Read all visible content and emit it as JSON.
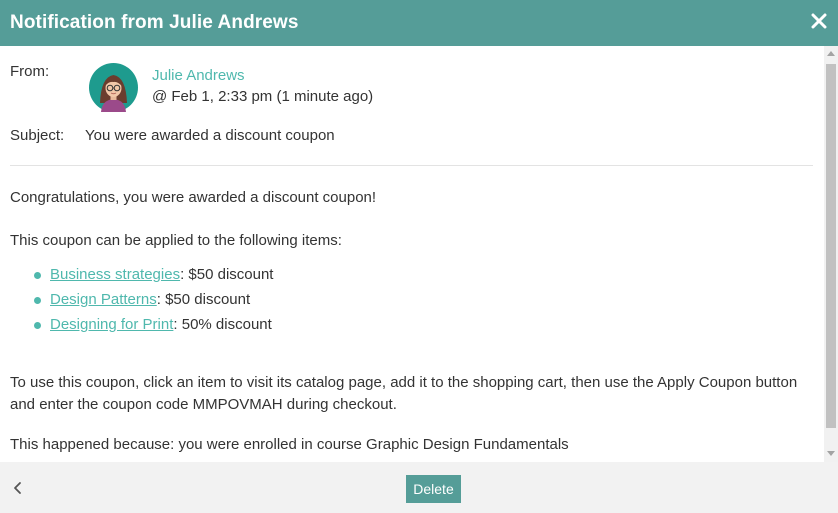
{
  "dialog": {
    "title": "Notification from Julie Andrews"
  },
  "message": {
    "from_label": "From:",
    "sender_name": "Julie Andrews",
    "timestamp": "@ Feb 1, 2:33 pm (1 minute ago)",
    "subject_label": "Subject:",
    "subject": "You were awarded a discount coupon",
    "congrats": "Congratulations, you were awarded a discount coupon!",
    "applies_text": "This coupon can be applied to the following items:",
    "items": [
      {
        "name": "Business strategies",
        "discount": ": $50 discount"
      },
      {
        "name": "Design Patterns",
        "discount": ": $50 discount"
      },
      {
        "name": "Designing for Print",
        "discount": ": 50% discount"
      }
    ],
    "instructions": "To use this coupon, click an item to visit its catalog page, add it to the shopping cart, then use the Apply Coupon button and enter the coupon code MMPOVMAH during checkout.",
    "reason": "This happened because: you were enrolled in course Graphic Design Fundamentals"
  },
  "footer": {
    "delete_label": "Delete"
  },
  "icons": {
    "close": "close-icon",
    "back": "chevron-left-icon",
    "avatar": "avatar-julie-andrews"
  },
  "colors": {
    "header": "#559d98",
    "accent_link": "#4fb8ad",
    "footer_bg": "#f2f2f2"
  }
}
